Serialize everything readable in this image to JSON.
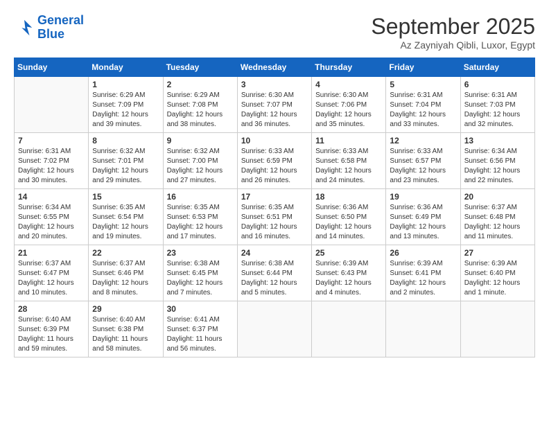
{
  "logo": {
    "line1": "General",
    "line2": "Blue"
  },
  "title": "September 2025",
  "subtitle": "Az Zayniyah Qibli, Luxor, Egypt",
  "days_of_week": [
    "Sunday",
    "Monday",
    "Tuesday",
    "Wednesday",
    "Thursday",
    "Friday",
    "Saturday"
  ],
  "weeks": [
    [
      {
        "day": "",
        "info": ""
      },
      {
        "day": "1",
        "info": "Sunrise: 6:29 AM\nSunset: 7:09 PM\nDaylight: 12 hours\nand 39 minutes."
      },
      {
        "day": "2",
        "info": "Sunrise: 6:29 AM\nSunset: 7:08 PM\nDaylight: 12 hours\nand 38 minutes."
      },
      {
        "day": "3",
        "info": "Sunrise: 6:30 AM\nSunset: 7:07 PM\nDaylight: 12 hours\nand 36 minutes."
      },
      {
        "day": "4",
        "info": "Sunrise: 6:30 AM\nSunset: 7:06 PM\nDaylight: 12 hours\nand 35 minutes."
      },
      {
        "day": "5",
        "info": "Sunrise: 6:31 AM\nSunset: 7:04 PM\nDaylight: 12 hours\nand 33 minutes."
      },
      {
        "day": "6",
        "info": "Sunrise: 6:31 AM\nSunset: 7:03 PM\nDaylight: 12 hours\nand 32 minutes."
      }
    ],
    [
      {
        "day": "7",
        "info": "Sunrise: 6:31 AM\nSunset: 7:02 PM\nDaylight: 12 hours\nand 30 minutes."
      },
      {
        "day": "8",
        "info": "Sunrise: 6:32 AM\nSunset: 7:01 PM\nDaylight: 12 hours\nand 29 minutes."
      },
      {
        "day": "9",
        "info": "Sunrise: 6:32 AM\nSunset: 7:00 PM\nDaylight: 12 hours\nand 27 minutes."
      },
      {
        "day": "10",
        "info": "Sunrise: 6:33 AM\nSunset: 6:59 PM\nDaylight: 12 hours\nand 26 minutes."
      },
      {
        "day": "11",
        "info": "Sunrise: 6:33 AM\nSunset: 6:58 PM\nDaylight: 12 hours\nand 24 minutes."
      },
      {
        "day": "12",
        "info": "Sunrise: 6:33 AM\nSunset: 6:57 PM\nDaylight: 12 hours\nand 23 minutes."
      },
      {
        "day": "13",
        "info": "Sunrise: 6:34 AM\nSunset: 6:56 PM\nDaylight: 12 hours\nand 22 minutes."
      }
    ],
    [
      {
        "day": "14",
        "info": "Sunrise: 6:34 AM\nSunset: 6:55 PM\nDaylight: 12 hours\nand 20 minutes."
      },
      {
        "day": "15",
        "info": "Sunrise: 6:35 AM\nSunset: 6:54 PM\nDaylight: 12 hours\nand 19 minutes."
      },
      {
        "day": "16",
        "info": "Sunrise: 6:35 AM\nSunset: 6:53 PM\nDaylight: 12 hours\nand 17 minutes."
      },
      {
        "day": "17",
        "info": "Sunrise: 6:35 AM\nSunset: 6:51 PM\nDaylight: 12 hours\nand 16 minutes."
      },
      {
        "day": "18",
        "info": "Sunrise: 6:36 AM\nSunset: 6:50 PM\nDaylight: 12 hours\nand 14 minutes."
      },
      {
        "day": "19",
        "info": "Sunrise: 6:36 AM\nSunset: 6:49 PM\nDaylight: 12 hours\nand 13 minutes."
      },
      {
        "day": "20",
        "info": "Sunrise: 6:37 AM\nSunset: 6:48 PM\nDaylight: 12 hours\nand 11 minutes."
      }
    ],
    [
      {
        "day": "21",
        "info": "Sunrise: 6:37 AM\nSunset: 6:47 PM\nDaylight: 12 hours\nand 10 minutes."
      },
      {
        "day": "22",
        "info": "Sunrise: 6:37 AM\nSunset: 6:46 PM\nDaylight: 12 hours\nand 8 minutes."
      },
      {
        "day": "23",
        "info": "Sunrise: 6:38 AM\nSunset: 6:45 PM\nDaylight: 12 hours\nand 7 minutes."
      },
      {
        "day": "24",
        "info": "Sunrise: 6:38 AM\nSunset: 6:44 PM\nDaylight: 12 hours\nand 5 minutes."
      },
      {
        "day": "25",
        "info": "Sunrise: 6:39 AM\nSunset: 6:43 PM\nDaylight: 12 hours\nand 4 minutes."
      },
      {
        "day": "26",
        "info": "Sunrise: 6:39 AM\nSunset: 6:41 PM\nDaylight: 12 hours\nand 2 minutes."
      },
      {
        "day": "27",
        "info": "Sunrise: 6:39 AM\nSunset: 6:40 PM\nDaylight: 12 hours\nand 1 minute."
      }
    ],
    [
      {
        "day": "28",
        "info": "Sunrise: 6:40 AM\nSunset: 6:39 PM\nDaylight: 11 hours\nand 59 minutes."
      },
      {
        "day": "29",
        "info": "Sunrise: 6:40 AM\nSunset: 6:38 PM\nDaylight: 11 hours\nand 58 minutes."
      },
      {
        "day": "30",
        "info": "Sunrise: 6:41 AM\nSunset: 6:37 PM\nDaylight: 11 hours\nand 56 minutes."
      },
      {
        "day": "",
        "info": ""
      },
      {
        "day": "",
        "info": ""
      },
      {
        "day": "",
        "info": ""
      },
      {
        "day": "",
        "info": ""
      }
    ]
  ]
}
